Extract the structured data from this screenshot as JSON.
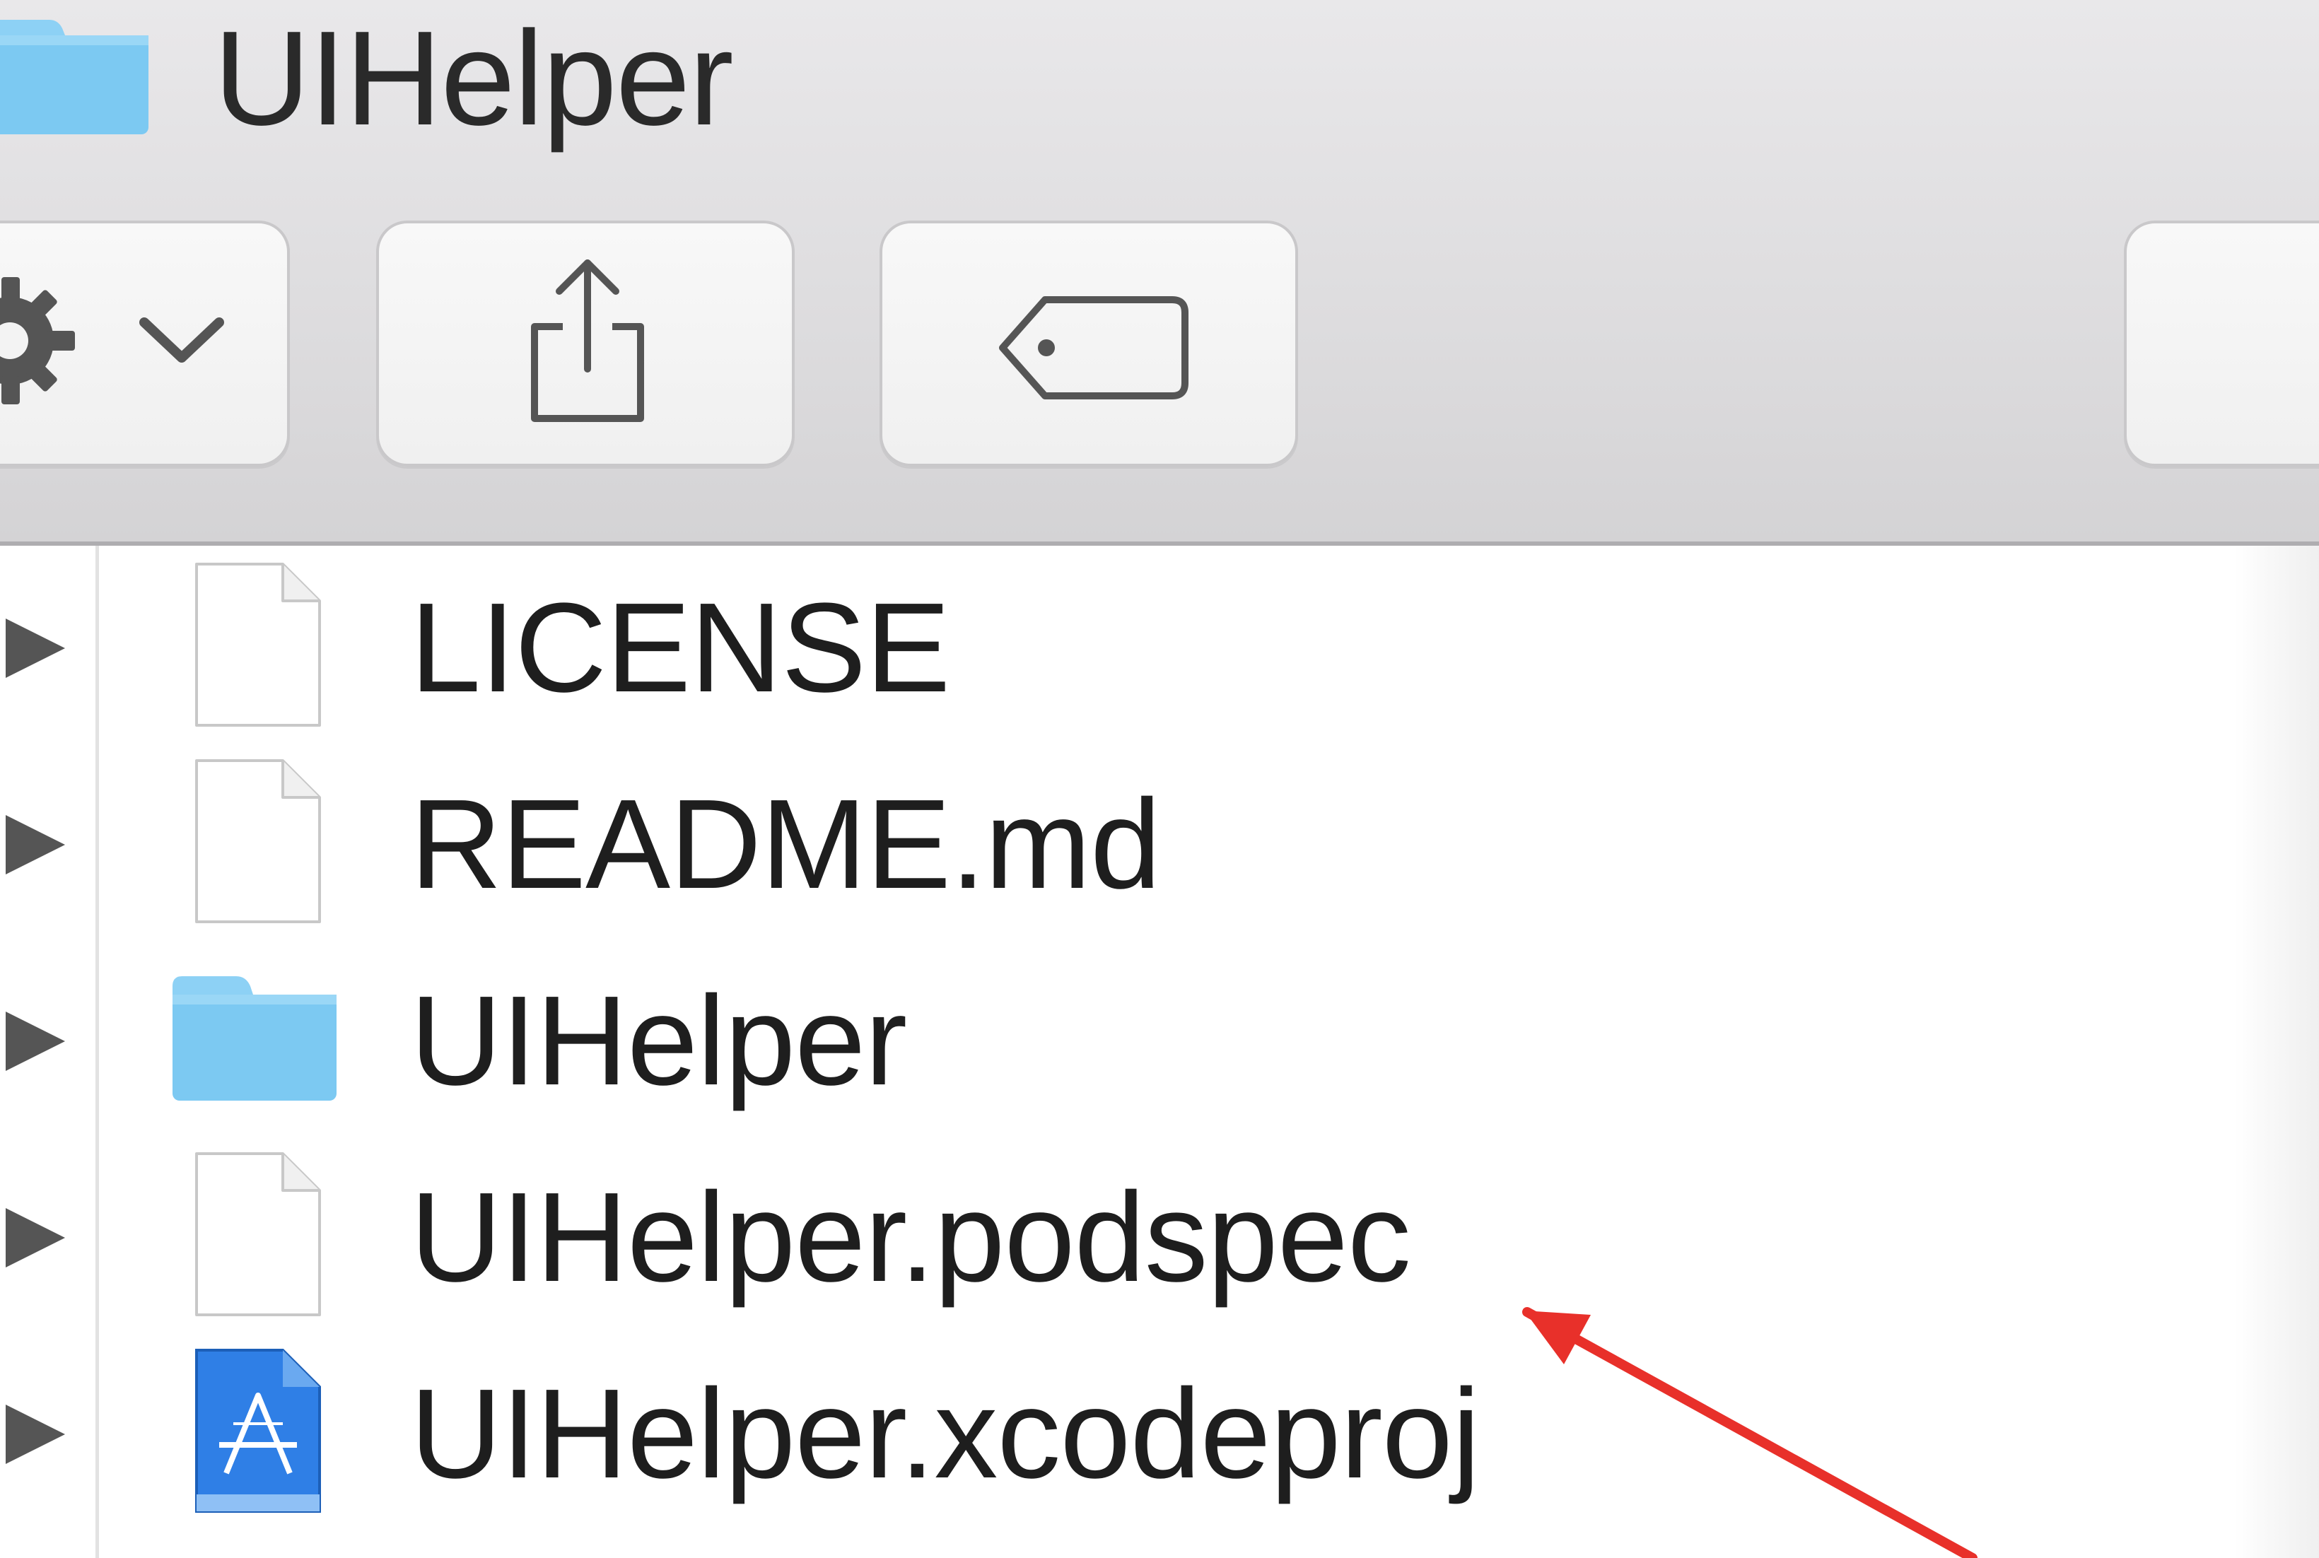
{
  "window": {
    "title": "UIHelper",
    "title_icon": "folder-icon"
  },
  "toolbar": {
    "buttons": [
      {
        "name": "action-button",
        "icons": [
          "gear-icon",
          "chevron-down-icon"
        ]
      },
      {
        "name": "share-button",
        "icons": [
          "share-icon"
        ]
      },
      {
        "name": "tags-button",
        "icons": [
          "tag-icon"
        ]
      }
    ]
  },
  "files": [
    {
      "label": "LICENSE",
      "icon": "document-icon"
    },
    {
      "label": "README.md",
      "icon": "document-icon"
    },
    {
      "label": "UIHelper",
      "icon": "folder-icon",
      "has_children": true
    },
    {
      "label": "UIHelper.podspec",
      "icon": "document-icon"
    },
    {
      "label": "UIHelper.xcodeproj",
      "icon": "xcode-project-icon"
    }
  ],
  "annotation": {
    "type": "red-arrow",
    "color": "#e8302a",
    "points_to": "UIHelper.podspec"
  },
  "colors": {
    "folder_blue": "#7cc9f2",
    "toolbar_bg": "#dddcde",
    "annotation_red": "#e8302a"
  }
}
